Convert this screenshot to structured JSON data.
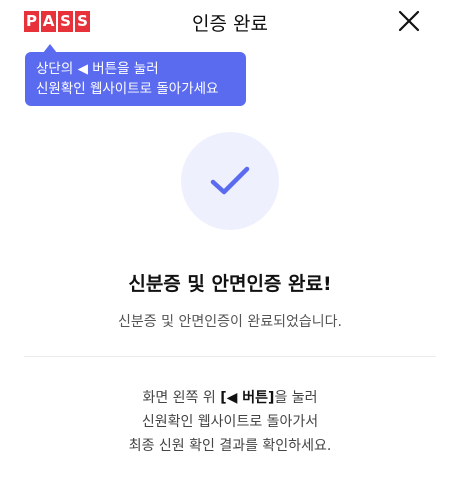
{
  "header": {
    "logo_letters": [
      "P",
      "A",
      "S",
      "S"
    ],
    "title": "인증 완료",
    "close_icon": "close-icon"
  },
  "tooltip": {
    "line1_prefix": "상단의",
    "line1_glyph": "◀",
    "line1_suffix": "버튼을 눌러",
    "line2": "신원확인 웹사이트로 돌아가세요"
  },
  "status": {
    "icon": "check-icon",
    "accent_color": "#5a6bf0",
    "headline": "신분증 및 안면인증 완료!",
    "subtitle": "신분증 및 안면인증이 완료되었습니다."
  },
  "instructions": {
    "line1_prefix": "화면 왼쪽 위",
    "line1_button": "[◀ 버튼]",
    "line1_suffix": "을 눌러",
    "line2": "신원확인 웹사이트로 돌아가서",
    "line3": "최종 신원 확인 결과를 확인하세요."
  }
}
